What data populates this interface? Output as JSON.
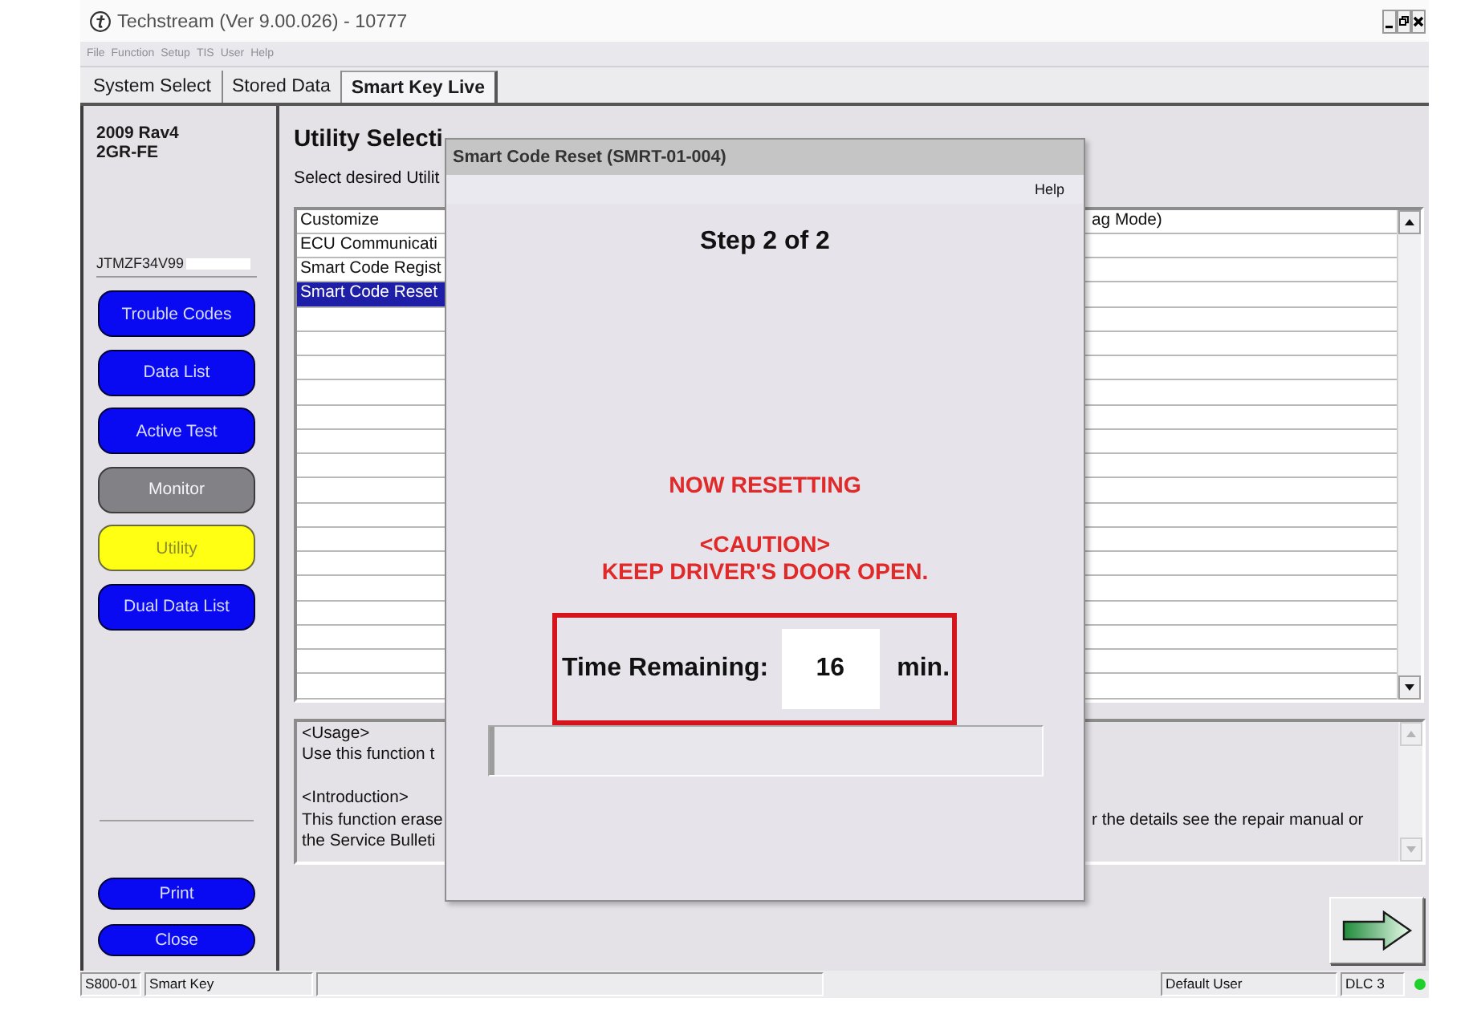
{
  "window": {
    "title": "Techstream (Ver 9.00.026) - 10777"
  },
  "menu": [
    {
      "label": "File",
      "disabled": true
    },
    {
      "label": "Function",
      "disabled": true
    },
    {
      "label": "Setup",
      "disabled": true
    },
    {
      "label": "TIS",
      "disabled": true
    },
    {
      "label": "User",
      "disabled": true
    },
    {
      "label": "Help",
      "disabled": true
    }
  ],
  "tabs": [
    {
      "label": "System Select",
      "selected": false
    },
    {
      "label": "Stored Data",
      "selected": false
    },
    {
      "label": "Smart Key Live",
      "selected": true
    }
  ],
  "sidebar": {
    "model": "2009 Rav4",
    "engine": "2GR-FE",
    "vin": "JTMZF34V99",
    "functions": [
      {
        "label": "Trouble Codes",
        "selected": false,
        "disabled": false
      },
      {
        "label": "Data List",
        "selected": false,
        "disabled": false
      },
      {
        "label": "Active Test",
        "selected": false,
        "disabled": false
      },
      {
        "label": "Monitor",
        "selected": false,
        "disabled": true
      },
      {
        "label": "Utility",
        "selected": true,
        "disabled": false
      },
      {
        "label": "Dual Data List",
        "selected": false,
        "disabled": false
      }
    ],
    "actions": [
      {
        "label": "Print"
      },
      {
        "label": "Close"
      }
    ]
  },
  "utility": {
    "heading": "Utility Selecti",
    "instruction": "Select desired Utilit",
    "items": [
      {
        "label": "Customize",
        "selected": false,
        "continuation": "ag Mode)"
      },
      {
        "label": "ECU Communicati",
        "selected": false
      },
      {
        "label": "Smart Code Regist",
        "selected": false
      },
      {
        "label": "Smart Code Reset",
        "selected": true
      }
    ],
    "usage": [
      {
        "heading": "<Usage>",
        "lines": [
          {
            "text": "Use this function t"
          }
        ]
      },
      {
        "heading": "<Introduction>",
        "lines": [
          {
            "text": "This function erase",
            "continuation": "r the details see the repair manual or"
          },
          {
            "text": "the Service Bulleti"
          }
        ]
      }
    ]
  },
  "dialog": {
    "title": "Smart Code Reset (SMRT-01-004)",
    "menu": [
      {
        "label": "Help"
      }
    ],
    "step": "Step 2 of 2",
    "message": "NOW RESETTING",
    "caution": [
      "<CAUTION>",
      "KEEP DRIVER'S DOOR OPEN."
    ],
    "timer": {
      "label": "Time Remaining:",
      "value": "16",
      "unit": "min."
    },
    "progress": {
      "level": 0.01
    }
  },
  "status_bar": {
    "panels": [
      "S800-01",
      "Smart Key"
    ],
    "user": "Default User",
    "port": "DLC 3",
    "connected": true
  }
}
